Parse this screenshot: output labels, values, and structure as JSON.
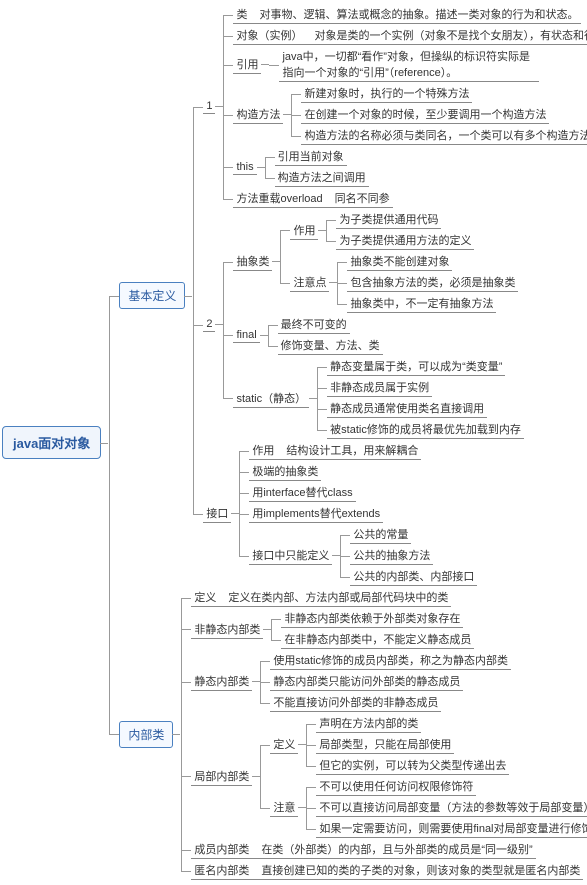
{
  "root": "java面对对象",
  "b1": {
    "label": "基本定义",
    "n1": {
      "label": "1",
      "class_k": "类",
      "class_v": "对事物、逻辑、算法或概念的抽象。描述一类对象的行为和状态。",
      "obj_k": "对象（实例）",
      "obj_v": "对象是类的一个实例（对象不是找个女朋友），有状态和行为。",
      "ref_k": "引用",
      "ref_v": "java中，一切都“看作”对象，但操纵的标识符实际是指向一个对象的“引用”（reference）。",
      "ctor": {
        "label": "构造方法",
        "c1": "新建对象时，执行的一个特殊方法",
        "c2": "在创建一个对象的时候，至少要调用一个构造方法",
        "c3": "构造方法的名称必须与类同名，一个类可以有多个构造方法"
      },
      "this": {
        "label": "this",
        "t1": "引用当前对象",
        "t2": "构造方法之间调用"
      },
      "overload_k": "方法重载overload",
      "overload_v": "同名不同参"
    },
    "n2": {
      "label": "2",
      "abs": {
        "label": "抽象类",
        "use": {
          "label": "作用",
          "u1": "为子类提供通用代码",
          "u2": "为子类提供通用方法的定义"
        },
        "note": {
          "label": "注意点",
          "n1": "抽象类不能创建对象",
          "n2": "包含抽象方法的类，必须是抽象类",
          "n3": "抽象类中，不一定有抽象方法"
        }
      },
      "final": {
        "label": "final",
        "f1": "最终不可变的",
        "f2": "修饰变量、方法、类"
      },
      "static": {
        "label": "static（静态）",
        "s1": "静态变量属于类，可以成为“类变量”",
        "s2": "非静态成员属于实例",
        "s3": "静态成员通常使用类名直接调用",
        "s4": "被static修饰的成员将最优先加载到内存"
      }
    },
    "iface": {
      "label": "接口",
      "use_k": "作用",
      "use_v": "结构设计工具，用来解耦合",
      "i1": "极端的抽象类",
      "i2": "用interface替代class",
      "i3": "用implements替代extends",
      "only": {
        "label": "接口中只能定义",
        "o1": "公共的常量",
        "o2": "公共的抽象方法",
        "o3": "公共的内部类、内部接口"
      }
    }
  },
  "b2": {
    "label": "内部类",
    "def_k": "定义",
    "def_v": "定义在类内部、方法内部或局部代码块中的类",
    "nonstatic": {
      "label": "非静态内部类",
      "a1": "非静态内部类依赖于外部类对象存在",
      "a2": "在非静态内部类中，不能定义静态成员"
    },
    "staticInner": {
      "label": "静态内部类",
      "a1": "使用static修饰的成员内部类，称之为静态内部类",
      "a2": "静态内部类只能访问外部类的静态成员",
      "a3": "不能直接访问外部类的非静态成员"
    },
    "local": {
      "label": "局部内部类",
      "def": {
        "label": "定义",
        "d1": "声明在方法内部的类",
        "d2": "局部类型，只能在局部使用",
        "d3": "但它的实例，可以转为父类型传递出去"
      },
      "note": {
        "label": "注意",
        "n1": "不可以使用任何访问权限修饰符",
        "n2": "不可以直接访问局部变量（方法的参数等效于局部变量）",
        "n3": "如果一定需要访问，则需要使用final对局部变量进行修饰"
      }
    },
    "member_k": "成员内部类",
    "member_v": "在类（外部类）的内部，且与外部类的成员是“同一级别”",
    "anon_k": "匿名内部类",
    "anon_v": "直接创建已知的类的子类的对象，则该对象的类型就是匿名内部类"
  }
}
